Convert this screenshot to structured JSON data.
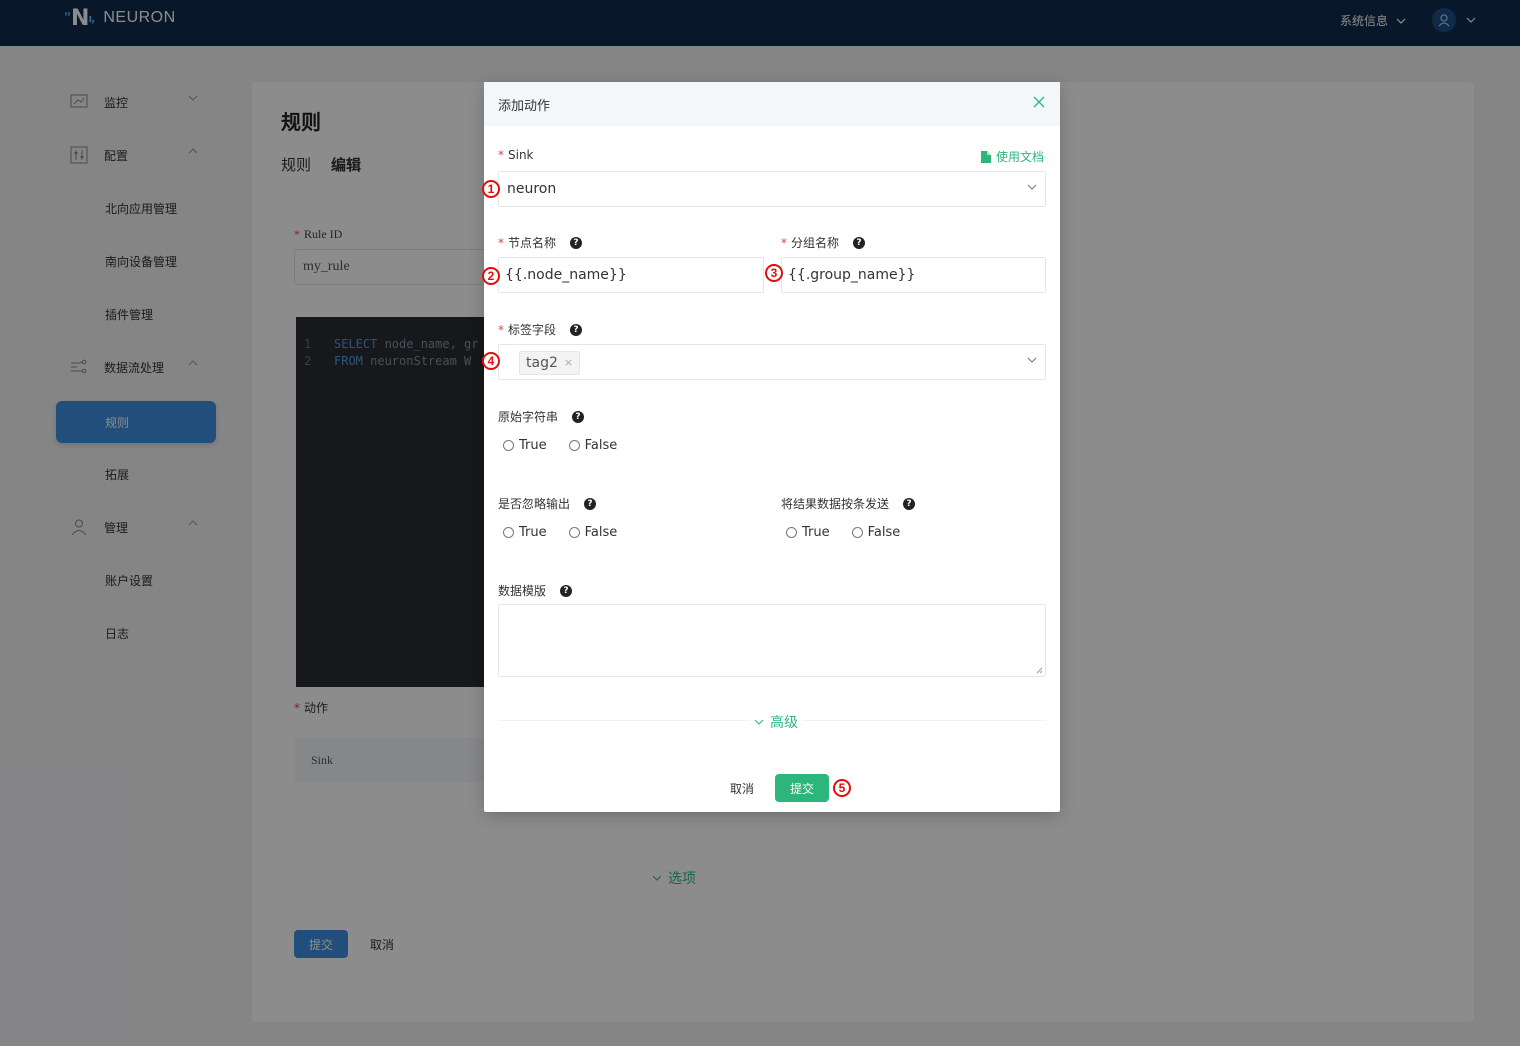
{
  "header": {
    "logo_text": "NEURON",
    "system_info_label": "系统信息"
  },
  "sidebar": {
    "items": [
      {
        "label": "监控"
      },
      {
        "label": "配置"
      },
      {
        "label": "北向应用管理"
      },
      {
        "label": "南向设备管理"
      },
      {
        "label": "插件管理"
      },
      {
        "label": "数据流处理"
      },
      {
        "label": "规则"
      },
      {
        "label": "拓展"
      },
      {
        "label": "管理"
      },
      {
        "label": "账户设置"
      },
      {
        "label": "日志"
      }
    ]
  },
  "main": {
    "title": "规则",
    "breadcrumb": [
      "规则",
      "编辑"
    ],
    "rule_id_label": "Rule ID",
    "rule_id_value": "my_rule",
    "sql_lines": [
      {
        "num": "1",
        "kw": "SELECT",
        "rest": " node_name, gr"
      },
      {
        "num": "2",
        "kw": "FROM",
        "rest": " neuronStream W"
      }
    ],
    "action_label": "动作",
    "sink_column": "Sink",
    "options_toggle": "选项",
    "submit_label": "提交",
    "cancel_label": "取消"
  },
  "modal": {
    "title": "添加动作",
    "doc_link": "使用文档",
    "sink": {
      "label": "Sink",
      "value": "neuron"
    },
    "node_name": {
      "label": "节点名称",
      "value": "{{.node_name}}"
    },
    "group_name": {
      "label": "分组名称",
      "value": "{{.group_name}}"
    },
    "tags": {
      "label": "标签字段",
      "chips": [
        "tag2"
      ]
    },
    "raw_string": {
      "label": "原始字符串",
      "options": [
        "True",
        "False"
      ]
    },
    "omit_output": {
      "label": "是否忽略输出",
      "options": [
        "True",
        "False"
      ]
    },
    "send_single": {
      "label": "将结果数据按条发送",
      "options": [
        "True",
        "False"
      ]
    },
    "data_template": {
      "label": "数据模版",
      "value": ""
    },
    "advanced_toggle": "高级",
    "cancel_label": "取消",
    "submit_label": "提交"
  },
  "annotations": [
    "1",
    "2",
    "3",
    "4",
    "5"
  ],
  "colors": {
    "header_bg": "#0f2d4d",
    "primary_blue": "#3d8fe0",
    "primary_green": "#2db67c",
    "annotation_red": "#e30d0d"
  }
}
